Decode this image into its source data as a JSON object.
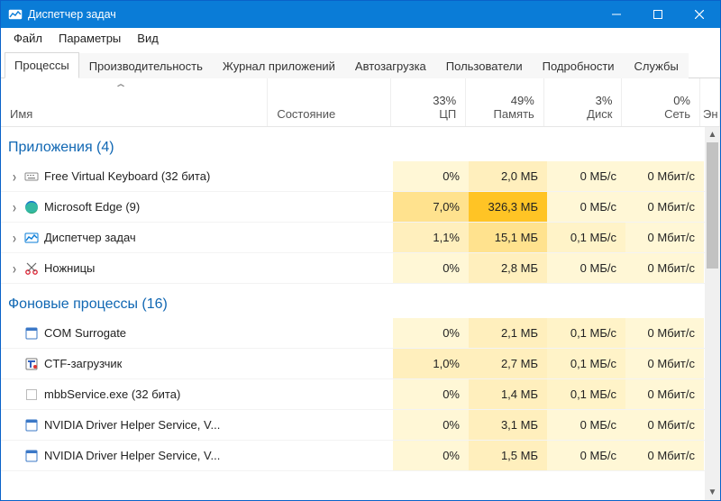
{
  "window": {
    "title": "Диспетчер задач"
  },
  "menu": {
    "file": "Файл",
    "options": "Параметры",
    "view": "Вид"
  },
  "tabs": {
    "processes": "Процессы",
    "performance": "Производительность",
    "app_history": "Журнал приложений",
    "startup": "Автозагрузка",
    "users": "Пользователи",
    "details": "Подробности",
    "services": "Службы"
  },
  "columns": {
    "name": "Имя",
    "status": "Состояние",
    "cpu_pct": "33%",
    "cpu_label": "ЦП",
    "mem_pct": "49%",
    "mem_label": "Память",
    "disk_pct": "3%",
    "disk_label": "Диск",
    "net_pct": "0%",
    "net_label": "Сеть",
    "energy_abbrev": "Эн"
  },
  "sections": {
    "apps": "Приложения (4)",
    "bg": "Фоновые процессы (16)"
  },
  "apps": [
    {
      "name": "Free Virtual Keyboard (32 бита)",
      "cpu": "0%",
      "mem": "2,0 МБ",
      "disk": "0 МБ/с",
      "net": "0 Мбит/с",
      "icon": "keyboard",
      "exp": true
    },
    {
      "name": "Microsoft Edge (9)",
      "cpu": "7,0%",
      "mem": "326,3 МБ",
      "disk": "0 МБ/с",
      "net": "0 Мбит/с",
      "icon": "edge",
      "exp": true
    },
    {
      "name": "Диспетчер задач",
      "cpu": "1,1%",
      "mem": "15,1 МБ",
      "disk": "0,1 МБ/с",
      "net": "0 Мбит/с",
      "icon": "taskmgr",
      "exp": true
    },
    {
      "name": "Ножницы",
      "cpu": "0%",
      "mem": "2,8 МБ",
      "disk": "0 МБ/с",
      "net": "0 Мбит/с",
      "icon": "snip",
      "exp": true
    }
  ],
  "bg": [
    {
      "name": "COM Surrogate",
      "cpu": "0%",
      "mem": "2,1 МБ",
      "disk": "0,1 МБ/с",
      "net": "0 Мбит/с",
      "icon": "exe"
    },
    {
      "name": "CTF-загрузчик",
      "cpu": "1,0%",
      "mem": "2,7 МБ",
      "disk": "0,1 МБ/с",
      "net": "0 Мбит/с",
      "icon": "ctf"
    },
    {
      "name": "mbbService.exe (32 бита)",
      "cpu": "0%",
      "mem": "1,4 МБ",
      "disk": "0,1 МБ/с",
      "net": "0 Мбит/с",
      "icon": "blank"
    },
    {
      "name": "NVIDIA Driver Helper Service, V...",
      "cpu": "0%",
      "mem": "3,1 МБ",
      "disk": "0 МБ/с",
      "net": "0 Мбит/с",
      "icon": "exe"
    },
    {
      "name": "NVIDIA Driver Helper Service, V...",
      "cpu": "0%",
      "mem": "1,5 МБ",
      "disk": "0 МБ/с",
      "net": "0 Мбит/с",
      "icon": "exe"
    }
  ],
  "heat": {
    "apps": [
      {
        "cpu": "heat1",
        "mem": "heat2",
        "disk": "heat1",
        "net": "heat1"
      },
      {
        "cpu": "heat3",
        "mem": "heat5",
        "disk": "heat1",
        "net": "heat1"
      },
      {
        "cpu": "heat2",
        "mem": "heat3",
        "disk": "heat1b",
        "net": "heat1"
      },
      {
        "cpu": "heat1",
        "mem": "heat2",
        "disk": "heat1",
        "net": "heat1"
      }
    ],
    "bg": [
      {
        "cpu": "heat1",
        "mem": "heat2",
        "disk": "heat1b",
        "net": "heat1"
      },
      {
        "cpu": "heat2",
        "mem": "heat2",
        "disk": "heat1b",
        "net": "heat1"
      },
      {
        "cpu": "heat1",
        "mem": "heat2",
        "disk": "heat1b",
        "net": "heat1"
      },
      {
        "cpu": "heat1",
        "mem": "heat2",
        "disk": "heat1",
        "net": "heat1"
      },
      {
        "cpu": "heat1",
        "mem": "heat2",
        "disk": "heat1",
        "net": "heat1"
      }
    ]
  }
}
